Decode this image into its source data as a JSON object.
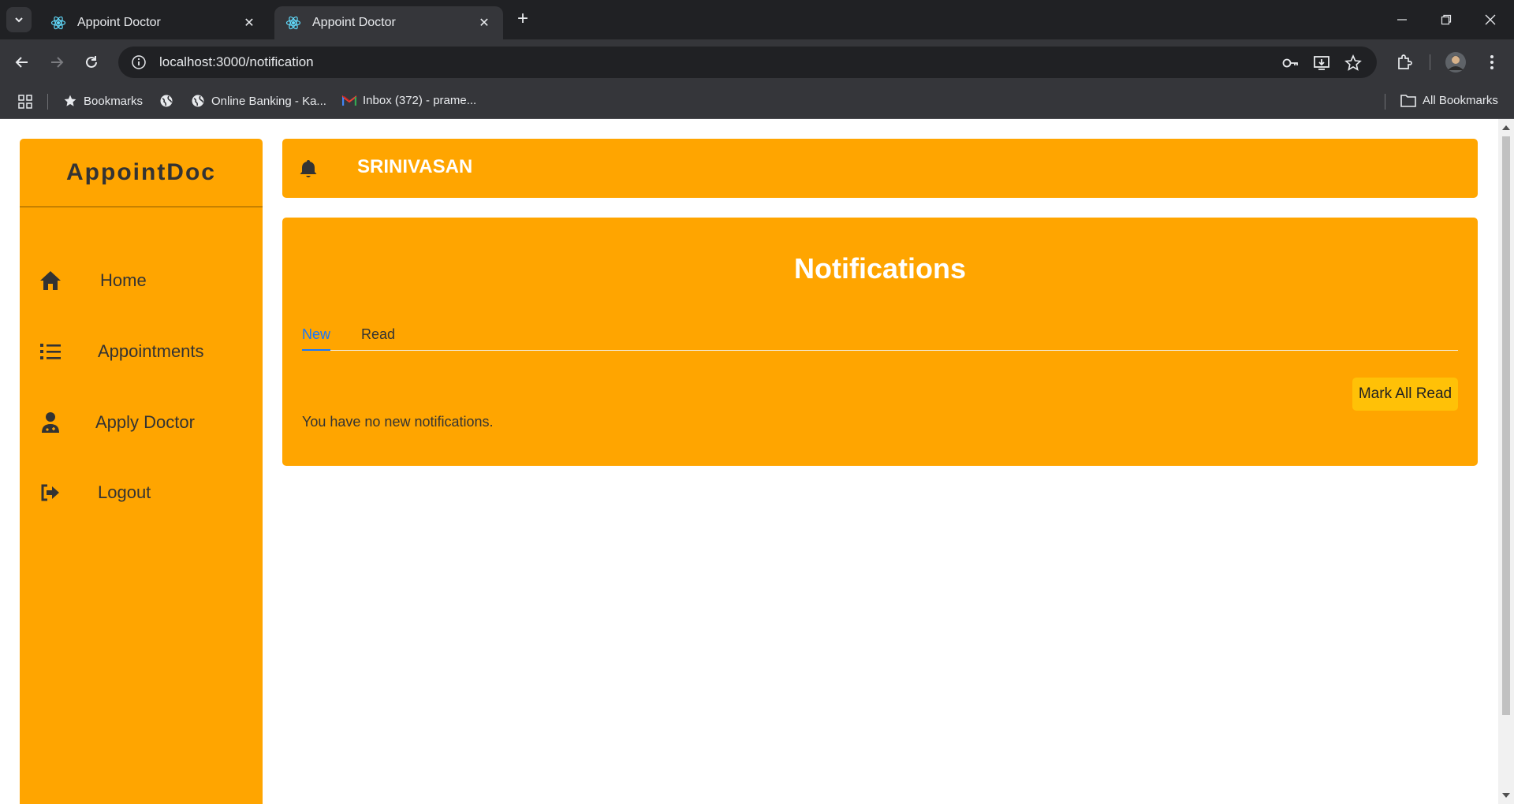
{
  "browser": {
    "tabs": [
      {
        "title": "Appoint Doctor",
        "active": false
      },
      {
        "title": "Appoint Doctor",
        "active": true
      }
    ],
    "url": "localhost:3000/notification",
    "bookmarks": [
      {
        "label": "Bookmarks",
        "icon": "star-icon"
      },
      {
        "label": "",
        "icon": "globe-icon"
      },
      {
        "label": "Online Banking - Ka...",
        "icon": "globe-icon"
      },
      {
        "label": "Inbox (372) - prame...",
        "icon": "gmail-icon"
      }
    ],
    "all_bookmarks": "All Bookmarks"
  },
  "app": {
    "logo": "AppointDoc",
    "menu": [
      {
        "label": "Home",
        "icon": "home-icon"
      },
      {
        "label": "Appointments",
        "icon": "list-icon"
      },
      {
        "label": "Apply Doctor",
        "icon": "doctor-icon"
      },
      {
        "label": "Logout",
        "icon": "logout-icon"
      }
    ],
    "header": {
      "user_name": "SRINIVASAN"
    },
    "notifications": {
      "title": "Notifications",
      "tabs": [
        {
          "label": "New",
          "active": true
        },
        {
          "label": "Read",
          "active": false
        }
      ],
      "mark_all_label": "Mark All Read",
      "empty_message": "You have no new notifications."
    }
  },
  "colors": {
    "accent": "#ffa500",
    "button": "#ffc107",
    "tab_active": "#1677ff"
  }
}
